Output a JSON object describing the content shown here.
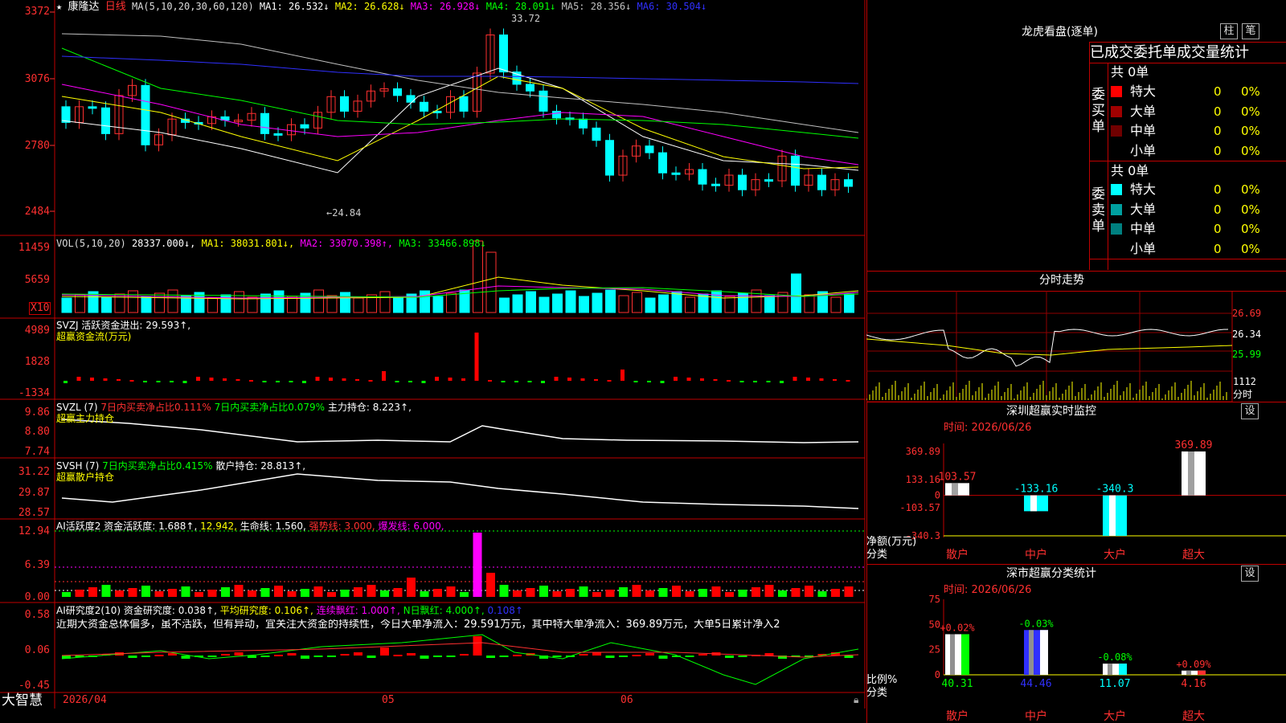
{
  "window": {
    "bottom_left": "大智慧",
    "dates": [
      "2026/04",
      "05",
      "06"
    ]
  },
  "main_chart": {
    "stock_name": "康隆达",
    "period": "日线",
    "ma_params": "MA(5,10,20,30,60,120)",
    "ma_values": [
      {
        "label": "MA1: 26.532↓",
        "color": "#ffffff"
      },
      {
        "label": "MA2: 26.628↓",
        "color": "#ffff00"
      },
      {
        "label": "MA3: 26.928↓",
        "color": "#ff00ff"
      },
      {
        "label": "MA4: 28.091↓",
        "color": "#00ff00"
      },
      {
        "label": "MA5: 28.356↓",
        "color": "#c0c0c0"
      },
      {
        "label": "MA6: 30.504↓",
        "color": "#3030ff"
      }
    ],
    "y_ticks": [
      "3372",
      "3076",
      "2780",
      "2484"
    ],
    "high_label": "33.72",
    "low_label": "←24.84"
  },
  "volume": {
    "header_left": "VOL(5,10,20)",
    "header_value": "28337.000↓,",
    "ma1": "MA1: 38031.801↓,",
    "ma2": "MA2: 33070.398↑,",
    "ma3": "MA3: 33466.898↓",
    "y_ticks": [
      "11459",
      "5659"
    ],
    "unit": "X10"
  },
  "svzj": {
    "header": "SVZJ  活跃资金进出: 29.593↑,",
    "subtitle": "超赢资金流(万元)",
    "y_ticks": [
      "4989",
      "1828",
      "-1334"
    ]
  },
  "svzl": {
    "header_a": "SVZL (7)",
    "header_b": "7日内买卖净占比0.111%",
    "header_c": "7日内买卖净占比0.079%",
    "header_d": "主力持仓: 8.223↑,",
    "subtitle": "超赢主力持仓",
    "y_ticks": [
      "9.86",
      "8.80",
      "7.74"
    ]
  },
  "svsh": {
    "header_a": "SVSH (7)",
    "header_b": "7日内买卖净占比0.415%",
    "header_c": "散户持仓: 28.813↑,",
    "subtitle": "超赢散户持仓",
    "y_ticks": [
      "31.22",
      "29.87",
      "28.57"
    ]
  },
  "ai_active": {
    "header_a": "AI活跃度2",
    "header_b": "资金活跃度: 1.688↑,",
    "header_c": "12.942,",
    "header_d": "生命线: 1.560,",
    "header_e": "强势线: 3.000,",
    "header_f": "爆发线: 6.000,",
    "y_ticks": [
      "12.94",
      "6.39",
      "0.00"
    ]
  },
  "ai_research": {
    "header_a": "AI研究度2(10)",
    "header_b": "资金研究度: 0.038↑,",
    "header_c": "平均研究度: 0.106↑,",
    "header_d": "连续飘红: 1.000↑,",
    "header_e": "N日飘红: 4.000↑,",
    "header_f": "0.108↑",
    "comment": "近期大资金总体偏多，虽不活跃，但有异动，宜关注大资金的持续性，今日大单净流入：29.591万元，其中特大单净流入：369.89万元，大单5日累计净入2",
    "y_ticks": [
      "0.58",
      "0.06",
      "-0.45"
    ]
  },
  "dragon_panel": {
    "title": "龙虎看盘(逐单)",
    "btn_a": "柱",
    "btn_b": "笔",
    "heading": "已成交委托单成交量统计",
    "buy_label": "委买单",
    "sell_label": "委卖单",
    "buy_total": "共 0单",
    "sell_total": "共 0单",
    "buy_rows": [
      {
        "name": "特大",
        "count": "0",
        "pct": "0%",
        "color": "#ff0000"
      },
      {
        "name": "大单",
        "count": "0",
        "pct": "0%",
        "color": "#a00000"
      },
      {
        "name": "中单",
        "count": "0",
        "pct": "0%",
        "color": "#700000"
      },
      {
        "name": "小单",
        "count": "0",
        "pct": "0%",
        "color": "#000000"
      }
    ],
    "sell_rows": [
      {
        "name": "特大",
        "count": "0",
        "pct": "0%",
        "color": "#00ffff"
      },
      {
        "name": "大单",
        "count": "0",
        "pct": "0%",
        "color": "#00a0a0"
      },
      {
        "name": "中单",
        "count": "0",
        "pct": "0%",
        "color": "#008080"
      },
      {
        "name": "小单",
        "count": "0",
        "pct": "0%",
        "color": "#000000"
      }
    ]
  },
  "intraday": {
    "title": "分时走势",
    "price_ticks": [
      "26.69",
      "26.34",
      "25.99"
    ],
    "vol_tick": "1112",
    "vol_unit": "分时"
  },
  "monitor": {
    "title": "深圳超赢实时监控",
    "btn": "设",
    "time": "时间: 2026/06/26",
    "y_ticks": [
      "369.89",
      "133.16",
      "0",
      "-103.57",
      "-340.3"
    ],
    "y_unit": "净额(万元)",
    "x_unit": "分类",
    "chart_data": {
      "type": "bar",
      "categories": [
        "散户",
        "中户",
        "大户",
        "超大"
      ],
      "values": [
        103.57,
        -133.16,
        -340.3,
        369.89
      ],
      "labels": [
        "103.57",
        "-133.16",
        "-340.3",
        "369.89"
      ]
    }
  },
  "classify": {
    "title": "深市超赢分类统计",
    "btn": "设",
    "time": "时间: 2026/06/26",
    "y_ticks": [
      "75",
      "50",
      "25",
      "0"
    ],
    "y_unit": "比例%",
    "x_unit": "分类",
    "chart_data": {
      "type": "bar",
      "categories": [
        "散户",
        "中户",
        "大户",
        "超大"
      ],
      "values": [
        40.31,
        44.46,
        11.07,
        4.16
      ],
      "value_labels": [
        "40.31",
        "44.46",
        "11.07",
        "4.16"
      ],
      "change_labels": [
        "+0.02%",
        "-0.03%",
        "-0.08%",
        "+0.09%"
      ]
    }
  }
}
